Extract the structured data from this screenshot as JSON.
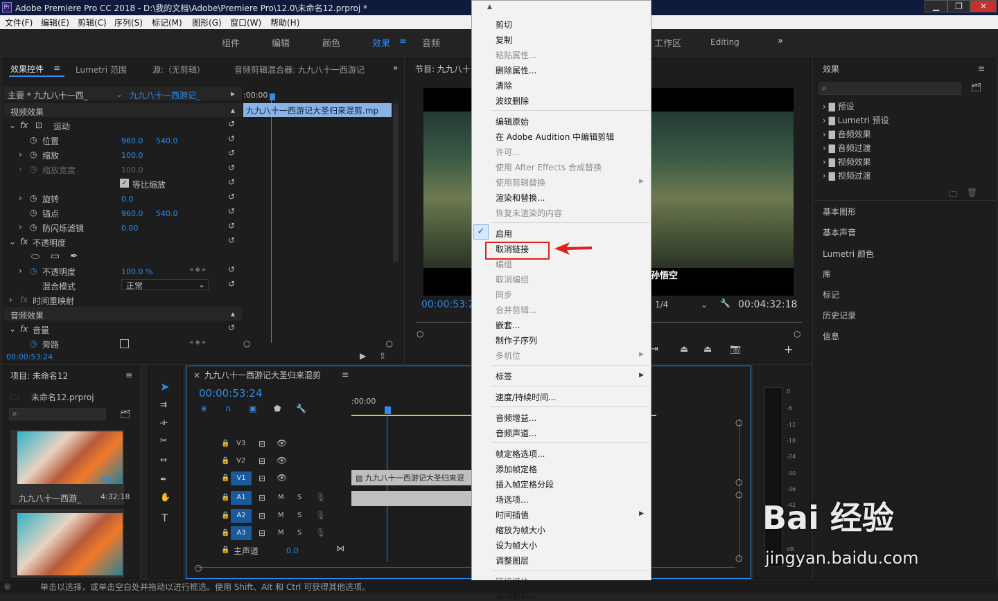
{
  "title_bar": {
    "icon": "Pr",
    "title": "Adobe Premiere Pro CC 2018 - D:\\我的文档\\Adobe\\Premiere Pro\\12.0\\未命名12.prproj *"
  },
  "menubar": [
    "文件(F)",
    "编辑(E)",
    "剪辑(C)",
    "序列(S)",
    "标记(M)",
    "图形(G)",
    "窗口(W)",
    "帮助(H)"
  ],
  "workspaces": {
    "items": [
      "组件",
      "编辑",
      "颜色",
      "效果",
      "音频"
    ],
    "active": "效果",
    "right": [
      "工作区",
      "Editing"
    ],
    "more": "»"
  },
  "effect_controls": {
    "tabs": [
      "效果控件",
      "Lumetri 范围",
      "源:（无剪辑）",
      "音频剪辑混合器: 九九八十一西游记"
    ],
    "master": "主要 * 九九八十一西_",
    "clip": "九九八十一西游记_",
    "timecode_header": ":00:00",
    "clip_bar": "九九八十一西游记大圣归来混剪.mp",
    "video_effects": "视频效果",
    "motion": "运动",
    "position": {
      "label": "位置",
      "x": "960.0",
      "y": "540.0"
    },
    "scale": {
      "label": "缩放",
      "value": "100.0"
    },
    "scale_width": {
      "label": "缩放宽度",
      "value": "100.0"
    },
    "uniform_scale": "等比缩放",
    "rotation": {
      "label": "旋转",
      "value": "0.0"
    },
    "anchor": {
      "label": "锚点",
      "x": "960.0",
      "y": "540.0"
    },
    "antiflicker": {
      "label": "防闪烁滤镜",
      "value": "0.00"
    },
    "opacity_group": "不透明度",
    "opacity": {
      "label": "不透明度",
      "value": "100.0 %"
    },
    "blend_mode": {
      "label": "混合模式",
      "value": "正常"
    },
    "time_remap": "时间重映射",
    "audio_effects": "音频效果",
    "volume": "音量",
    "bypass": "旁路",
    "current_time": "00:00:53:24"
  },
  "program_monitor": {
    "title": "节目: 九九八十",
    "timecode": "00:00:53:2",
    "duration": "00:04:32:18",
    "zoom": "1/4",
    "subtitle": "孙悟空"
  },
  "effects_panel": {
    "title": "效果",
    "tree": [
      "预设",
      "Lumetri 预设",
      "音频效果",
      "音频过渡",
      "视频效果",
      "视频过渡"
    ],
    "sections": [
      "基本图形",
      "基本声音",
      "Lumetri 颜色",
      "库",
      "标记",
      "历史记录",
      "信息"
    ]
  },
  "project_panel": {
    "title": "项目: 未命名12",
    "file": "未命名12.prproj",
    "item_name": "九九八十一西游_",
    "item_duration": "4:32:18"
  },
  "timeline": {
    "title": "九九八十一西游记大圣归来混剪",
    "timecode": "00:00:53:24",
    "ruler": ":00:00",
    "tracks": [
      "V3",
      "V2",
      "V1",
      "A1",
      "A2",
      "A3"
    ],
    "master": {
      "label": "主声道",
      "value": "0.0"
    },
    "clip_label": "九九八十一西游记大圣归来混"
  },
  "meter_labels": [
    "0",
    "-6",
    "-12",
    "-18",
    "-24",
    "-30",
    "-36",
    "-42",
    "-48",
    "dB"
  ],
  "context_menu": {
    "items": [
      {
        "label": "剪切",
        "enabled": true
      },
      {
        "label": "复制",
        "enabled": true
      },
      {
        "label": "粘贴属性...",
        "enabled": false
      },
      {
        "label": "删除属性...",
        "enabled": true
      },
      {
        "label": "清除",
        "enabled": true
      },
      {
        "label": "波纹删除",
        "enabled": true
      },
      {
        "label": "编辑原始",
        "enabled": true
      },
      {
        "label": "在 Adobe Audition 中编辑剪辑",
        "enabled": true
      },
      {
        "label": "许可...",
        "enabled": false
      },
      {
        "label": "使用 After Effects 合成替换",
        "enabled": false
      },
      {
        "label": "使用剪辑替换",
        "enabled": false
      },
      {
        "label": "渲染和替换...",
        "enabled": true
      },
      {
        "label": "恢复未渲染的内容",
        "enabled": false
      },
      {
        "label": "启用",
        "enabled": true,
        "checked": true
      },
      {
        "label": "取消链接",
        "enabled": true,
        "highlight": true
      },
      {
        "label": "编组",
        "enabled": false
      },
      {
        "label": "取消编组",
        "enabled": false
      },
      {
        "label": "同步",
        "enabled": false
      },
      {
        "label": "合并剪辑...",
        "enabled": false
      },
      {
        "label": "嵌套...",
        "enabled": true
      },
      {
        "label": "制作子序列",
        "enabled": true
      },
      {
        "label": "多机位",
        "enabled": false
      },
      {
        "label": "标签",
        "enabled": true
      },
      {
        "label": "速度/持续时间...",
        "enabled": true
      },
      {
        "label": "音频增益...",
        "enabled": true
      },
      {
        "label": "音频声道...",
        "enabled": true
      },
      {
        "label": "帧定格选项...",
        "enabled": true
      },
      {
        "label": "添加帧定格",
        "enabled": true
      },
      {
        "label": "插入帧定格分段",
        "enabled": true
      },
      {
        "label": "场选项...",
        "enabled": true
      },
      {
        "label": "时间插值",
        "enabled": true
      },
      {
        "label": "缩放为帧大小",
        "enabled": true
      },
      {
        "label": "设为帧大小",
        "enabled": true
      },
      {
        "label": "调整图层",
        "enabled": true
      },
      {
        "label": "链接媒体...",
        "enabled": false
      },
      {
        "label": "设为脱机...",
        "enabled": true
      }
    ]
  },
  "status_bar": "单击以选择，或单击空白处并拖动以进行框选。使用 Shift、Alt 和 Ctrl 可获得其他选项。",
  "watermark": {
    "brand": "Bai 经验",
    "url": "jingyan.baidu.com"
  },
  "colors": {
    "accent_blue": "#2d8ceb",
    "highlight_red": "#e02020"
  }
}
